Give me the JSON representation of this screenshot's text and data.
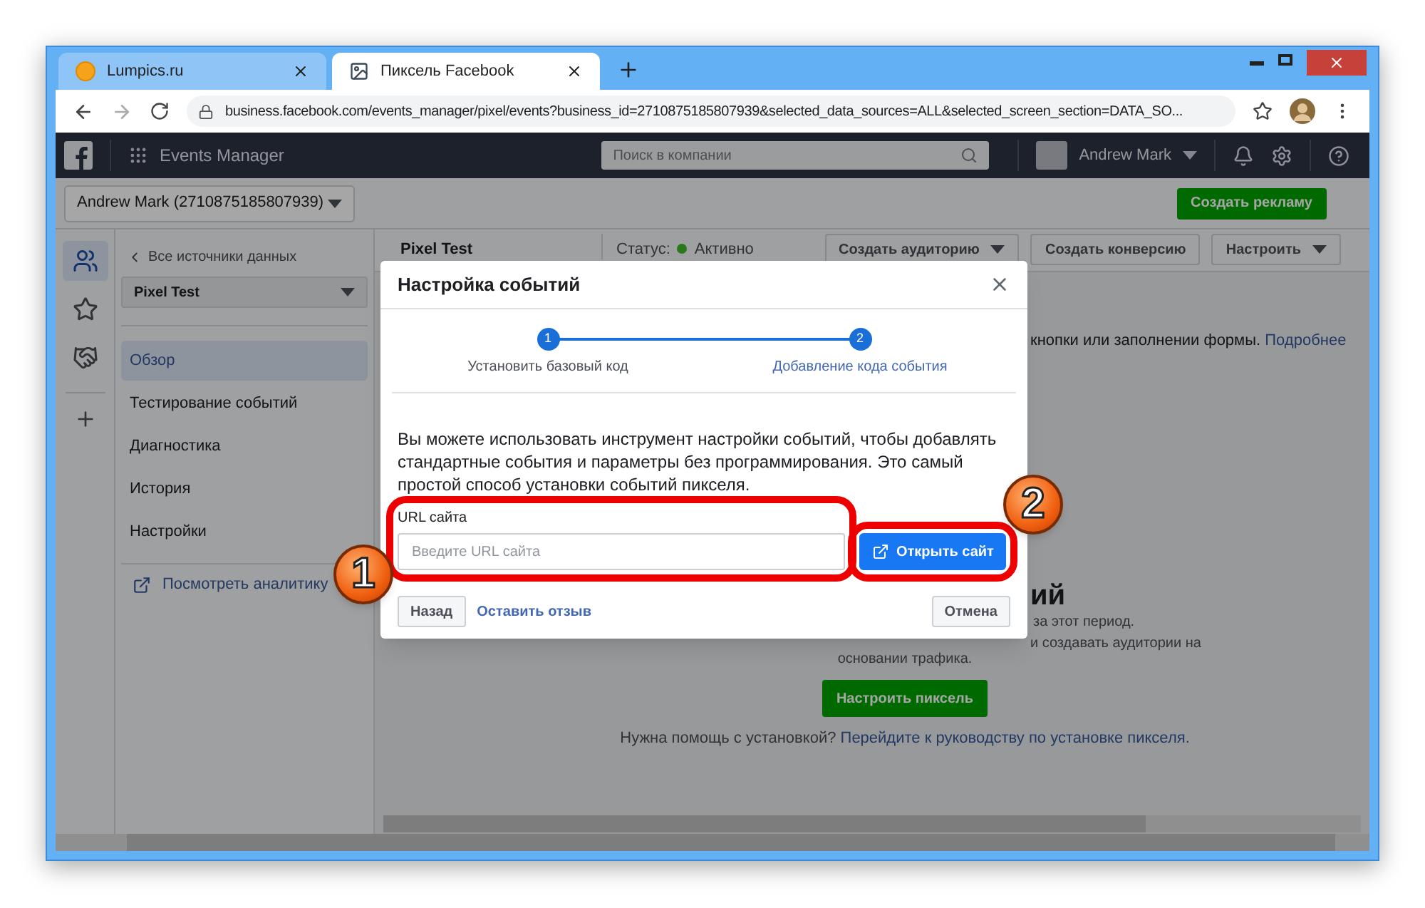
{
  "browser": {
    "tabs": [
      {
        "title": "Lumpics.ru",
        "selected": false,
        "kind": "circle"
      },
      {
        "title": "Пиксель Facebook",
        "selected": true,
        "kind": "image"
      }
    ],
    "url": "business.facebook.com/events_manager/pixel/events?business_id=2710875185807939&selected_data_sources=ALL&selected_screen_section=DATA_SO..."
  },
  "header": {
    "app_title": "Events Manager",
    "search_placeholder": "Поиск в компании",
    "user": "Andrew Mark"
  },
  "account_select": "Andrew Mark (2710875185807939)",
  "create_ad_button": "Создать рекламу",
  "rail": [
    {
      "kind": "people",
      "selected": true
    },
    {
      "kind": "star",
      "selected": false
    },
    {
      "kind": "handshake",
      "selected": false
    }
  ],
  "sidebar": {
    "back_link": "Все источники данных",
    "pixel_select": "Pixel Test",
    "items": [
      {
        "label": "Обзор",
        "selected": true
      },
      {
        "label": "Тестирование событий",
        "selected": false
      },
      {
        "label": "Диагностика",
        "selected": false
      },
      {
        "label": "История",
        "selected": false
      },
      {
        "label": "Настройки",
        "selected": false
      }
    ],
    "analytics_link": "Посмотреть аналитику"
  },
  "main": {
    "pixel_name": "Pixel Test",
    "status_label": "Статус:",
    "status": "Активно",
    "buttons": [
      {
        "label": "Создать аудиторию",
        "dropdown": true
      },
      {
        "label": "Создать конверсию",
        "dropdown": false
      },
      {
        "label": "Настроить",
        "dropdown": true
      }
    ],
    "intro_fragment": "кнопки или заполнении формы.",
    "intro_link": "Подробнее",
    "heading_fragment": "ий",
    "text_fragments": [
      "за этот период.",
      "и создавать аудитории на"
    ],
    "text_line": "основании трафика.",
    "setup_button": "Настроить пиксель",
    "help_text": "Нужна помощь с установкой?",
    "help_link": "Перейдите к руководству по установке пикселя."
  },
  "modal": {
    "title": "Настройка событий",
    "steps": [
      {
        "number": "1",
        "label": "Установить базовый код",
        "selected": false
      },
      {
        "number": "2",
        "label": "Добавление кода события",
        "selected": true
      }
    ],
    "description": "Вы можете использовать инструмент настройки событий, чтобы добавлять стандартные события и параметры без программирования. Это самый простой способ установки событий пикселя.",
    "url_label": "URL сайта",
    "url_placeholder": "Введите URL сайта",
    "open_button": "Открыть сайт",
    "back_button": "Назад",
    "feedback_link": "Оставить отзыв",
    "cancel_button": "Отмена"
  },
  "annotations": [
    {
      "number": "1"
    },
    {
      "number": "2"
    }
  ]
}
